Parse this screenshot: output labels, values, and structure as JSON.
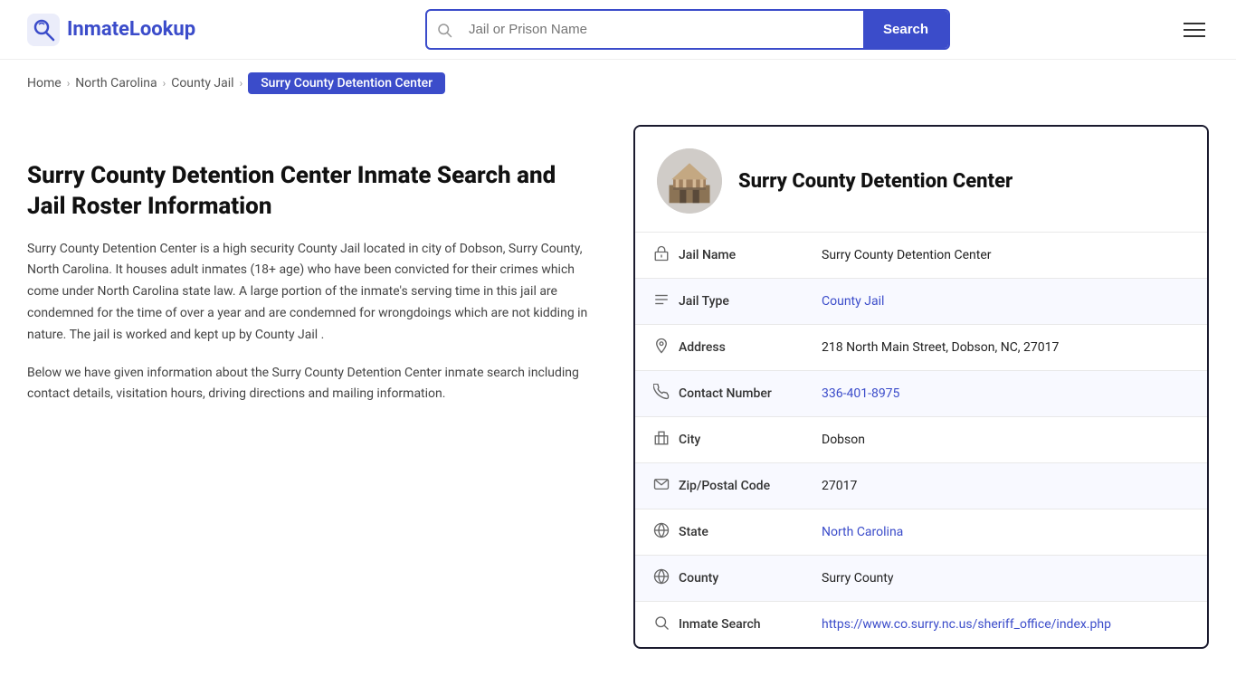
{
  "header": {
    "logo_text_prefix": "Inmate",
    "logo_text_suffix": "Lookup",
    "search_placeholder": "Jail or Prison Name",
    "search_button_label": "Search"
  },
  "breadcrumb": {
    "home": "Home",
    "state": "North Carolina",
    "type": "County Jail",
    "current": "Surry County Detention Center"
  },
  "left": {
    "heading": "Surry County Detention Center Inmate Search and Jail Roster Information",
    "desc1": "Surry County Detention Center is a high security County Jail located in city of Dobson, Surry County, North Carolina. It houses adult inmates (18+ age) who have been convicted for their crimes which come under North Carolina state law. A large portion of the inmate's serving time in this jail are condemned for the time of over a year and are condemned for wrongdoings which are not kidding in nature. The jail is worked and kept up by County Jail .",
    "desc2": "Below we have given information about the Surry County Detention Center inmate search including contact details, visitation hours, driving directions and mailing information."
  },
  "card": {
    "facility_name": "Surry County Detention Center",
    "rows": [
      {
        "icon": "jail",
        "label": "Jail Name",
        "value": "Surry County Detention Center",
        "link": null
      },
      {
        "icon": "type",
        "label": "Jail Type",
        "value": "County Jail",
        "link": "#"
      },
      {
        "icon": "address",
        "label": "Address",
        "value": "218 North Main Street, Dobson, NC, 27017",
        "link": null
      },
      {
        "icon": "phone",
        "label": "Contact Number",
        "value": "336-401-8975",
        "link": "tel:336-401-8975"
      },
      {
        "icon": "city",
        "label": "City",
        "value": "Dobson",
        "link": null
      },
      {
        "icon": "zip",
        "label": "Zip/Postal Code",
        "value": "27017",
        "link": null
      },
      {
        "icon": "globe",
        "label": "State",
        "value": "North Carolina",
        "link": "#"
      },
      {
        "icon": "county",
        "label": "County",
        "value": "Surry County",
        "link": null
      },
      {
        "icon": "search",
        "label": "Inmate Search",
        "value": "https://www.co.surry.nc.us/sheriff_office/index.php",
        "link": "https://www.co.surry.nc.us/sheriff_office/index.php"
      }
    ]
  }
}
